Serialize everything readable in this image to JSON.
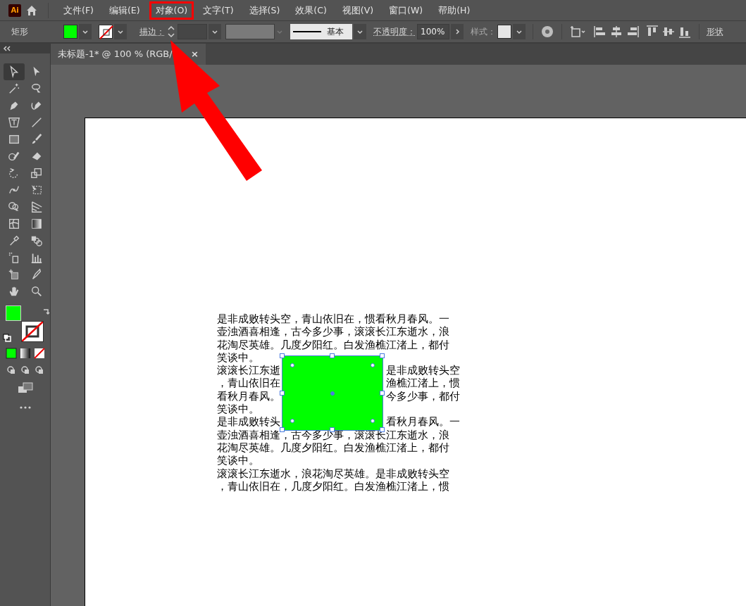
{
  "menu_bar": {
    "logo": "Ai",
    "items": [
      {
        "label": "文件(F)",
        "highlighted": false
      },
      {
        "label": "编辑(E)",
        "highlighted": false
      },
      {
        "label": "对象(O)",
        "highlighted": true
      },
      {
        "label": "文字(T)",
        "highlighted": false
      },
      {
        "label": "选择(S)",
        "highlighted": false
      },
      {
        "label": "效果(C)",
        "highlighted": false
      },
      {
        "label": "视图(V)",
        "highlighted": false
      },
      {
        "label": "窗口(W)",
        "highlighted": false
      },
      {
        "label": "帮助(H)",
        "highlighted": false
      }
    ]
  },
  "control_bar": {
    "object_type": "矩形",
    "fill": {
      "color": "#00ff00"
    },
    "stroke": {
      "kind": "none"
    },
    "stroke_label": "描边：",
    "width_profile": {
      "disabled": true
    },
    "profile": "基本",
    "opacity_label": "不透明度：",
    "opacity": "100%",
    "style_label": "样式：",
    "shape_label": "形状"
  },
  "toolbar": {
    "tools": [
      {
        "kind": "select",
        "selected": true
      },
      {
        "kind": "direct",
        "selected": false
      },
      {
        "kind": "wand",
        "selected": false
      },
      {
        "kind": "lasso",
        "selected": false
      },
      {
        "kind": "pen",
        "selected": false
      },
      {
        "kind": "curvepen",
        "selected": false
      },
      {
        "kind": "type",
        "selected": false
      },
      {
        "kind": "line",
        "selected": false
      },
      {
        "kind": "rect",
        "selected": false
      },
      {
        "kind": "brush",
        "selected": false
      },
      {
        "kind": "shaper",
        "selected": false
      },
      {
        "kind": "eraser",
        "selected": false
      },
      {
        "kind": "rotate",
        "selected": false
      },
      {
        "kind": "scale",
        "selected": false
      },
      {
        "kind": "warp",
        "selected": false
      },
      {
        "kind": "freetransform",
        "selected": false
      },
      {
        "kind": "shapebuilder",
        "selected": false
      },
      {
        "kind": "perspective",
        "selected": false
      },
      {
        "kind": "mesh",
        "selected": false
      },
      {
        "kind": "gradient",
        "selected": false
      },
      {
        "kind": "eyedropper",
        "selected": false
      },
      {
        "kind": "blend",
        "selected": false
      },
      {
        "kind": "sprayer",
        "selected": false
      },
      {
        "kind": "graph",
        "selected": false
      },
      {
        "kind": "artboard",
        "selected": false
      },
      {
        "kind": "knife",
        "selected": false
      },
      {
        "kind": "hand",
        "selected": false
      },
      {
        "kind": "zoom",
        "selected": false
      }
    ],
    "fill": {
      "color": "#00ff00"
    },
    "stroke": {
      "kind": "none"
    }
  },
  "document": {
    "tab": {
      "title": "未标题-1* @ 100 % (RGB/",
      "close": "×"
    },
    "text_lines": [
      {
        "left": "是非成败转头空，青山依旧在，惯看秋月春风。一"
      },
      {
        "left": "壶浊酒喜相逢，古今多少事，滚滚长江东逝水，浪"
      },
      {
        "left": "花淘尽英雄。几度夕阳红。白发渔樵江渚上，都付"
      },
      {
        "left": "笑谈中。"
      },
      {
        "left": "滚滚长江东逝",
        "right": "是非成败转头空"
      },
      {
        "left": "，青山依旧在",
        "right": "渔樵江渚上，惯"
      },
      {
        "left": "看秋月春风。",
        "right": "今多少事，都付"
      },
      {
        "left": "笑谈中。"
      },
      {
        "left": "是非成败转头",
        "right": "看秋月春风。一"
      },
      {
        "left": "壶浊酒喜相逢，古今多少事，滚滚长江东逝水，浪"
      },
      {
        "left": "花淘尽英雄。几度夕阳红。白发渔樵江渚上，都付"
      },
      {
        "left": "笑谈中。"
      },
      {
        "left": "滚滚长江东逝水，浪花淘尽英雄。是非成败转头空"
      },
      {
        "left": "，青山依旧在，几度夕阳红。白发渔樵江渚上，惯"
      }
    ],
    "shape": {
      "color": "#00ff00",
      "selected": true
    }
  }
}
